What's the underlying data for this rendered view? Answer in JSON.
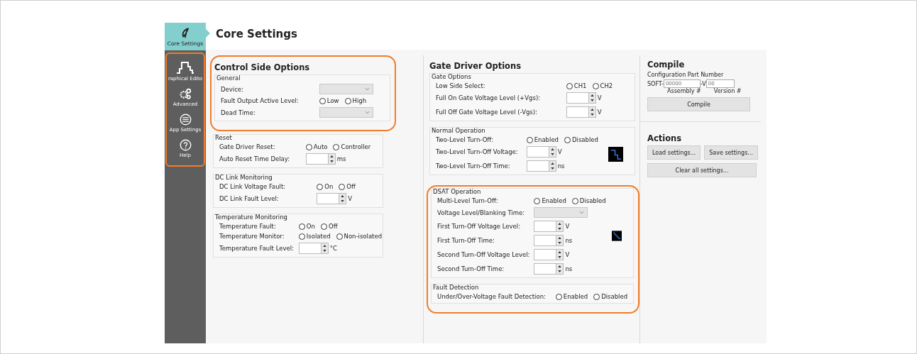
{
  "sidebar": {
    "items": [
      {
        "label": "Core Settings",
        "selected": true,
        "highlighted": false
      },
      {
        "label": "raphical Edito",
        "selected": false,
        "highlighted": true
      },
      {
        "label": "Advanced",
        "selected": false,
        "highlighted": true
      },
      {
        "label": "App Settings",
        "selected": false,
        "highlighted": true
      },
      {
        "label": "Help",
        "selected": false,
        "highlighted": true
      }
    ]
  },
  "page_title": "Core Settings",
  "columns": [
    {
      "blocks": [
        {
          "highlighted": true,
          "items": [
            {
              "kind": "title",
              "text": "Control Side Options"
            },
            {
              "kind": "group",
              "title": "General",
              "rows": [
                {
                  "kind": "dropdown",
                  "label": "Device:"
                },
                {
                  "kind": "radio",
                  "label": "Fault Output Active Level:",
                  "options": [
                    {
                      "label": "Low",
                      "selected": false
                    },
                    {
                      "label": "High",
                      "selected": false
                    }
                  ]
                },
                {
                  "kind": "dropdown",
                  "label": "Dead Time:"
                }
              ]
            }
          ]
        },
        {
          "highlighted": false,
          "items": [
            {
              "kind": "group",
              "title": "Reset",
              "rows": [
                {
                  "kind": "radio",
                  "label": "Gate Driver Reset:",
                  "options": [
                    {
                      "label": "Auto",
                      "selected": false
                    },
                    {
                      "label": "Controller",
                      "selected": false
                    }
                  ]
                },
                {
                  "kind": "spin",
                  "label": "Auto Reset Time Delay:",
                  "unit": "ms"
                }
              ]
            },
            {
              "kind": "group",
              "title": "DC Link Monitoring",
              "rows": [
                {
                  "kind": "radio",
                  "label": "DC Link Voltage Fault:",
                  "options": [
                    {
                      "label": "On",
                      "selected": false
                    },
                    {
                      "label": "Off",
                      "selected": false
                    }
                  ]
                },
                {
                  "kind": "spin",
                  "label": "DC Link Fault Level:",
                  "unit": "V"
                }
              ]
            },
            {
              "kind": "group",
              "title": "Temperature Monitoring",
              "rows": [
                {
                  "kind": "radio",
                  "label": "Temperature Fault:",
                  "options": [
                    {
                      "label": "On",
                      "selected": false
                    },
                    {
                      "label": "Off",
                      "selected": false
                    }
                  ]
                },
                {
                  "kind": "radio",
                  "label": "Temperature Monitor:",
                  "options": [
                    {
                      "label": "Isolated",
                      "selected": false
                    },
                    {
                      "label": "Non-isolated",
                      "selected": false
                    }
                  ]
                },
                {
                  "kind": "spin",
                  "label": "Temperature Fault Level:",
                  "unit": "°C"
                }
              ]
            }
          ]
        }
      ]
    },
    {
      "blocks": [
        {
          "highlighted": false,
          "items": [
            {
              "kind": "title",
              "text": "Gate Driver Options"
            },
            {
              "kind": "group",
              "title": "Gate Options",
              "rows": [
                {
                  "kind": "radio",
                  "label": "Low Side Select:",
                  "options": [
                    {
                      "label": "CH1",
                      "selected": false
                    },
                    {
                      "label": "CH2",
                      "selected": false
                    }
                  ]
                },
                {
                  "kind": "spin",
                  "label": "Full On Gate Voltage Level (+Vgs):",
                  "unit": "V"
                },
                {
                  "kind": "spin",
                  "label": "Full Off Gate Voltage Level (-Vgs):",
                  "unit": "V"
                }
              ]
            },
            {
              "kind": "twolevel",
              "title": "Normal Operation",
              "rows": [
                {
                  "kind": "radio",
                  "label": "Two-Level Turn-Off:",
                  "options": [
                    {
                      "label": "Enabled",
                      "selected": false
                    },
                    {
                      "label": "Disabled",
                      "selected": false
                    }
                  ]
                },
                {
                  "kind": "spin",
                  "label": "Two-Level Turn-Off Voltage:",
                  "unit": "V"
                },
                {
                  "kind": "spin",
                  "label": "Two-Level Turn-Off Time:",
                  "unit": "ns"
                }
              ]
            }
          ]
        },
        {
          "highlighted": true,
          "items": [
            {
              "kind": "multilevel",
              "title": "DSAT Operation",
              "rows": [
                {
                  "kind": "radio",
                  "label": "Multi-Level Turn-Off:",
                  "options": [
                    {
                      "label": "Enabled",
                      "selected": false
                    },
                    {
                      "label": "Disabled",
                      "selected": false
                    }
                  ]
                },
                {
                  "kind": "dropdown",
                  "label": "Voltage Level/Blanking Time:"
                },
                {
                  "kind": "spin",
                  "label": "First Turn-Off Voltage Level:",
                  "unit": "V"
                },
                {
                  "kind": "spin",
                  "label": "First Turn-Off Time:",
                  "unit": "ns"
                },
                {
                  "kind": "spin",
                  "label": "Second Turn-Off Voltage Level:",
                  "unit": "V"
                },
                {
                  "kind": "spin",
                  "label": "Second Turn-Off Time:",
                  "unit": "ns"
                }
              ]
            },
            {
              "kind": "group",
              "title": "Fault Detection",
              "rows": [
                {
                  "kind": "radio",
                  "label": "Under/Over-Voltage Fault Detection:",
                  "options": [
                    {
                      "label": "Enabled",
                      "selected": false
                    },
                    {
                      "label": "Disabled",
                      "selected": false
                    }
                  ]
                }
              ]
            }
          ]
        }
      ]
    }
  ],
  "compile": {
    "title": "Compile",
    "part_label": "Configuration Part Number",
    "prefix": "SOFT-",
    "assembly_placeholder": "00000",
    "separator": "-V",
    "version_placeholder": "00",
    "assembly_caption": "Assembly #",
    "version_caption": "Version #",
    "button": "Compile"
  },
  "actions": {
    "title": "Actions",
    "buttons": [
      "Load settings...",
      "Save settings...",
      "Clear all settings..."
    ]
  }
}
